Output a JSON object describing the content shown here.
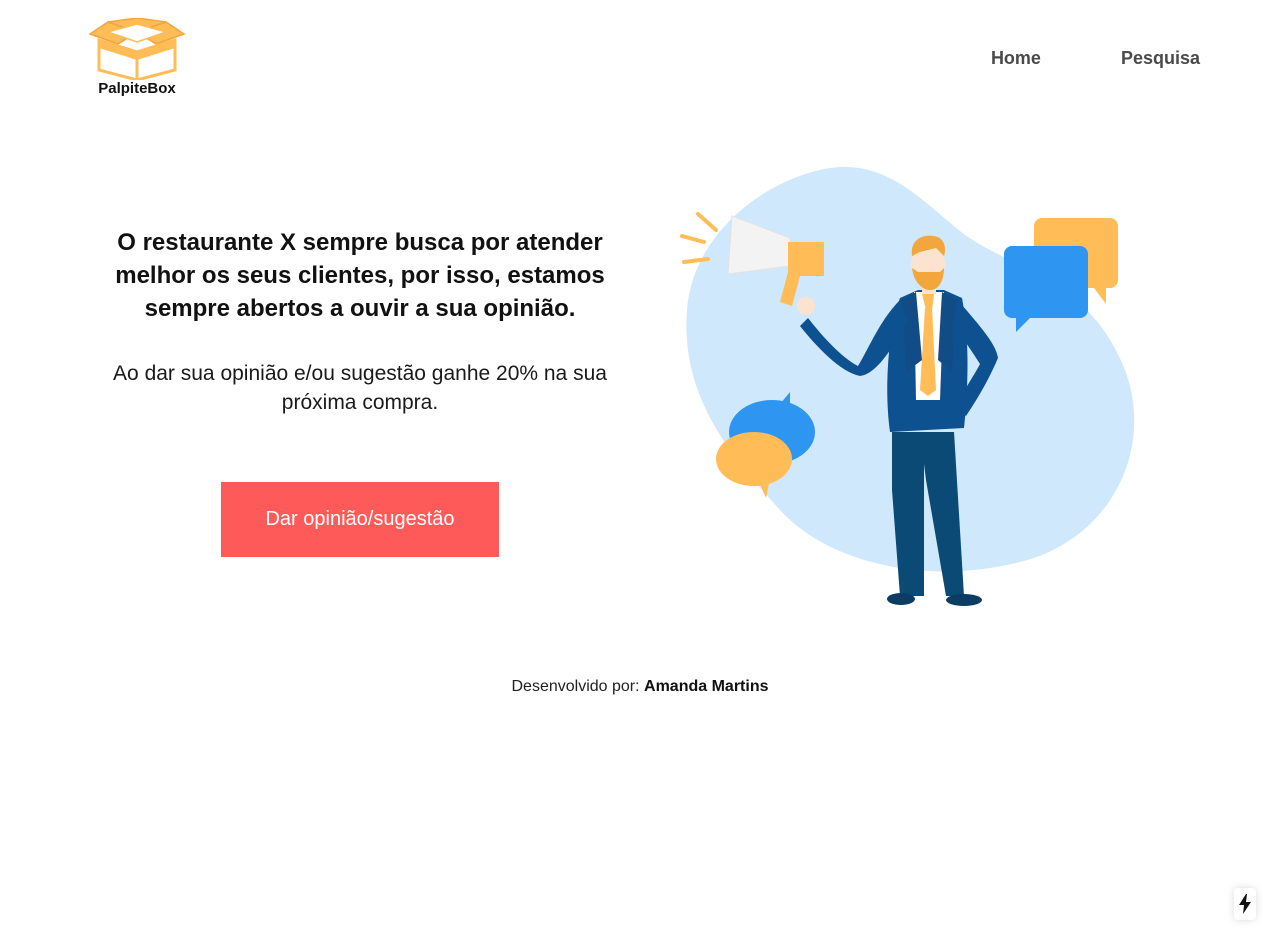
{
  "brand": {
    "name": "PalpiteBox",
    "logo_icon": "open-box-icon",
    "logo_color": "#FFBC57"
  },
  "nav": {
    "items": [
      {
        "label": "Home"
      },
      {
        "label": "Pesquisa"
      }
    ]
  },
  "hero": {
    "title": "O restaurante X sempre busca por atender melhor os seus clientes, por isso, estamos sempre abertos a ouvir a sua opinião.",
    "subtitle": "Ao dar sua opinião e/ou sugestão ganhe 20% na sua próxima compra.",
    "cta_label": "Dar opinião/sugestão",
    "cta_color": "#FF5A5A",
    "illustration_icon": "businessman-megaphone-illustration"
  },
  "footer": {
    "prefix": "Desenvolvido por:",
    "author": "Amanda Martins"
  },
  "badge": {
    "icon": "lightning-bolt-icon"
  },
  "colors": {
    "accent_yellow": "#FFBC57",
    "accent_blue": "#2E96F0",
    "blob_blue": "#CFE8FC",
    "suit_navy": "#0D5190"
  }
}
